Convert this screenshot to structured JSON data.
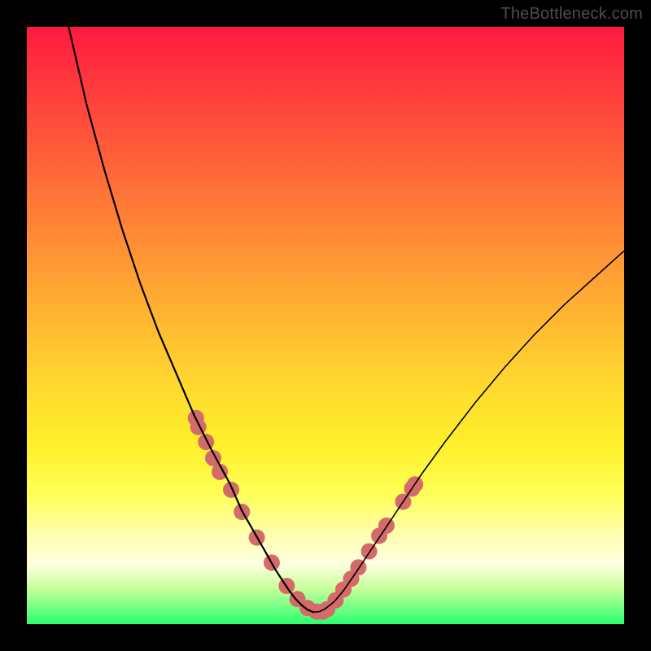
{
  "watermark": "TheBottleneck.com",
  "chart_data": {
    "type": "line",
    "title": "",
    "xlabel": "",
    "ylabel": "",
    "xlim": [
      0,
      100
    ],
    "ylim": [
      0,
      100
    ],
    "grid": false,
    "series": [
      {
        "name": "left-curve",
        "x": [
          7,
          10,
          13,
          16,
          19,
          22,
          25,
          28,
          31,
          34,
          36,
          38,
          40,
          41.5,
          43,
          44,
          45,
          46,
          47,
          48
        ],
        "y": [
          100,
          87,
          76,
          66,
          57,
          49,
          42,
          35,
          29,
          23.5,
          19,
          15.5,
          12,
          9.3,
          7,
          5.5,
          4.2,
          3.2,
          2.4,
          2
        ],
        "stroke": "#000000",
        "line_width": 2.2
      },
      {
        "name": "right-curve",
        "x": [
          48,
          49,
          50,
          51.5,
          53,
          55,
          58,
          62,
          66,
          70,
          75,
          80,
          85,
          90,
          95,
          100
        ],
        "y": [
          2,
          2.1,
          2.6,
          3.8,
          5.6,
          8.5,
          13,
          19,
          25,
          30.5,
          37,
          43,
          48.5,
          53.5,
          58,
          62.5
        ],
        "stroke": "#000000",
        "line_width": 1.6
      }
    ],
    "scatter": {
      "name": "markers",
      "color": "#d46a6a",
      "radius_px": 10,
      "points": [
        {
          "x": 28.3,
          "y": 34.5
        },
        {
          "x": 28.7,
          "y": 33.0
        },
        {
          "x": 30.0,
          "y": 30.5
        },
        {
          "x": 31.2,
          "y": 27.8
        },
        {
          "x": 32.3,
          "y": 25.5
        },
        {
          "x": 34.2,
          "y": 22.5
        },
        {
          "x": 36.0,
          "y": 18.8
        },
        {
          "x": 38.5,
          "y": 14.5
        },
        {
          "x": 41.0,
          "y": 10.3
        },
        {
          "x": 43.5,
          "y": 6.4
        },
        {
          "x": 45.3,
          "y": 4.2
        },
        {
          "x": 47.0,
          "y": 2.7
        },
        {
          "x": 48.5,
          "y": 2.1
        },
        {
          "x": 49.5,
          "y": 2.1
        },
        {
          "x": 50.3,
          "y": 2.5
        },
        {
          "x": 51.7,
          "y": 4.0
        },
        {
          "x": 53.0,
          "y": 5.8
        },
        {
          "x": 54.3,
          "y": 7.6
        },
        {
          "x": 55.5,
          "y": 9.5
        },
        {
          "x": 57.3,
          "y": 12.2
        },
        {
          "x": 59.0,
          "y": 14.8
        },
        {
          "x": 60.2,
          "y": 16.5
        },
        {
          "x": 63.0,
          "y": 20.5
        },
        {
          "x": 64.5,
          "y": 22.7
        },
        {
          "x": 65.0,
          "y": 23.4
        }
      ]
    },
    "gradient_stops": [
      {
        "pos": 0.0,
        "color": "#ff1a3f"
      },
      {
        "pos": 0.1,
        "color": "#ff3a3d"
      },
      {
        "pos": 0.2,
        "color": "#ff5a3a"
      },
      {
        "pos": 0.3,
        "color": "#ff7a37"
      },
      {
        "pos": 0.4,
        "color": "#ff9a34"
      },
      {
        "pos": 0.5,
        "color": "#ffba31"
      },
      {
        "pos": 0.6,
        "color": "#ffd92e"
      },
      {
        "pos": 0.7,
        "color": "#fff02b"
      },
      {
        "pos": 0.78,
        "color": "#ffff55"
      },
      {
        "pos": 0.85,
        "color": "#ffffb0"
      },
      {
        "pos": 0.9,
        "color": "#ffffe0"
      },
      {
        "pos": 0.94,
        "color": "#c8ff9a"
      },
      {
        "pos": 1.0,
        "color": "#2bff70"
      }
    ]
  }
}
